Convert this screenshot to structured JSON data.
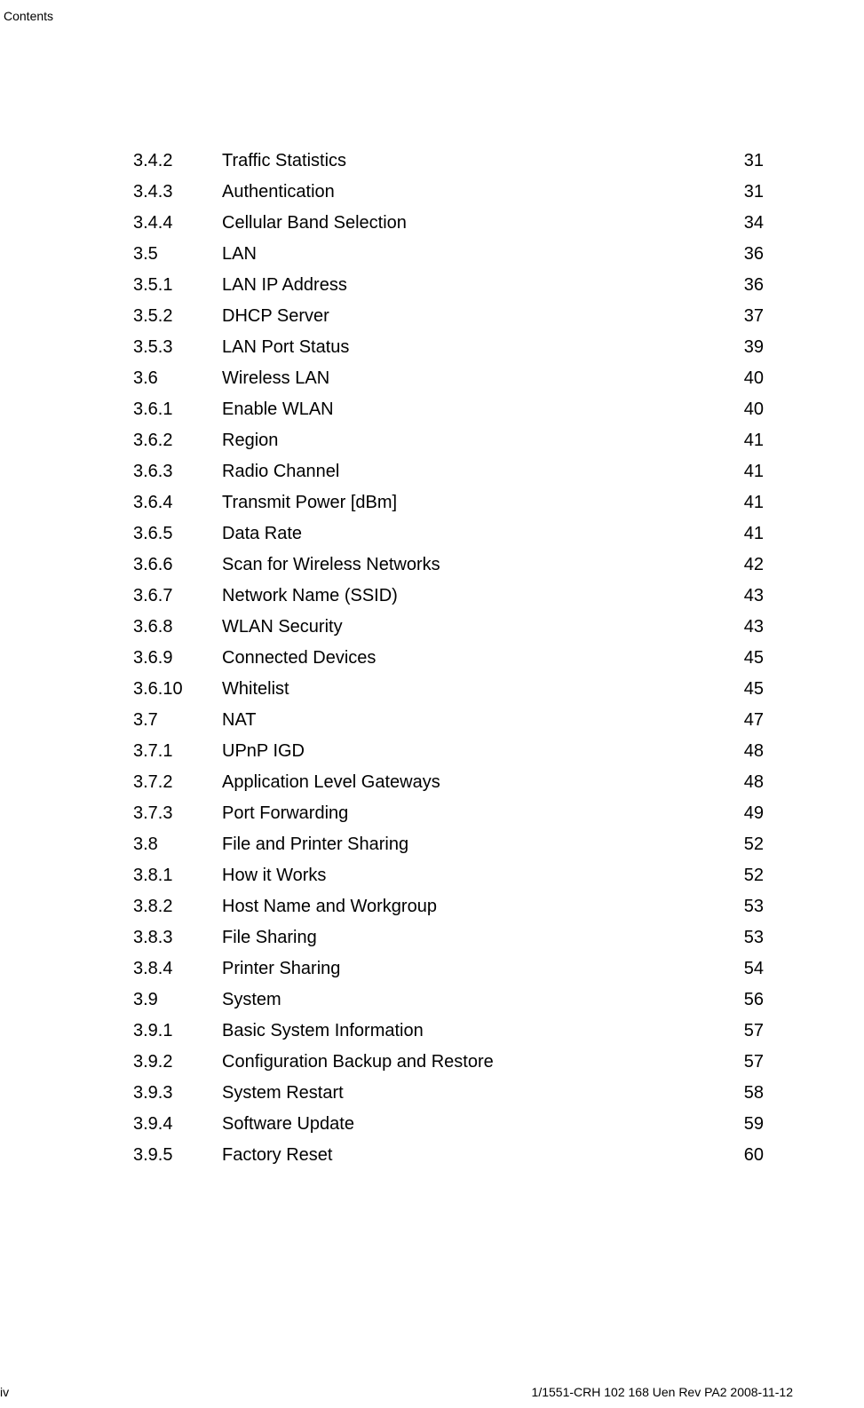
{
  "header": {
    "label": "Contents"
  },
  "toc": {
    "entries": [
      {
        "num": "3.4.2",
        "title": "Traffic Statistics",
        "page": "31"
      },
      {
        "num": "3.4.3",
        "title": "Authentication",
        "page": "31"
      },
      {
        "num": "3.4.4",
        "title": "Cellular Band Selection",
        "page": "34"
      },
      {
        "num": "3.5",
        "title": "LAN",
        "page": "36"
      },
      {
        "num": "3.5.1",
        "title": "LAN IP Address",
        "page": "36"
      },
      {
        "num": "3.5.2",
        "title": "DHCP Server",
        "page": "37"
      },
      {
        "num": "3.5.3",
        "title": "LAN Port Status",
        "page": "39"
      },
      {
        "num": "3.6",
        "title": "Wireless LAN",
        "page": "40"
      },
      {
        "num": "3.6.1",
        "title": "Enable WLAN",
        "page": "40"
      },
      {
        "num": "3.6.2",
        "title": "Region",
        "page": "41"
      },
      {
        "num": "3.6.3",
        "title": "Radio Channel",
        "page": "41"
      },
      {
        "num": "3.6.4",
        "title": "Transmit Power [dBm]",
        "page": "41"
      },
      {
        "num": "3.6.5",
        "title": "Data Rate",
        "page": "41"
      },
      {
        "num": "3.6.6",
        "title": "Scan for Wireless Networks",
        "page": "42"
      },
      {
        "num": "3.6.7",
        "title": "Network Name (SSID)",
        "page": "43"
      },
      {
        "num": "3.6.8",
        "title": "WLAN Security",
        "page": "43"
      },
      {
        "num": "3.6.9",
        "title": "Connected Devices",
        "page": "45"
      },
      {
        "num": "3.6.10",
        "title": "Whitelist",
        "page": "45"
      },
      {
        "num": "3.7",
        "title": "NAT",
        "page": "47"
      },
      {
        "num": "3.7.1",
        "title": "UPnP IGD",
        "page": "48"
      },
      {
        "num": "3.7.2",
        "title": "Application Level Gateways",
        "page": "48"
      },
      {
        "num": "3.7.3",
        "title": "Port Forwarding",
        "page": "49"
      },
      {
        "num": "3.8",
        "title": "File and Printer Sharing",
        "page": "52"
      },
      {
        "num": "3.8.1",
        "title": "How it Works",
        "page": "52"
      },
      {
        "num": "3.8.2",
        "title": "Host Name and Workgroup",
        "page": "53"
      },
      {
        "num": "3.8.3",
        "title": "File Sharing",
        "page": "53"
      },
      {
        "num": "3.8.4",
        "title": "Printer Sharing",
        "page": "54"
      },
      {
        "num": "3.9",
        "title": "System",
        "page": "56"
      },
      {
        "num": "3.9.1",
        "title": "Basic System Information",
        "page": "57"
      },
      {
        "num": "3.9.2",
        "title": "Configuration Backup and Restore",
        "page": "57"
      },
      {
        "num": "3.9.3",
        "title": "System Restart",
        "page": "58"
      },
      {
        "num": "3.9.4",
        "title": "Software Update",
        "page": "59"
      },
      {
        "num": "3.9.5",
        "title": "Factory Reset",
        "page": "60"
      }
    ]
  },
  "footer": {
    "page_num": "iv",
    "doc_id": "1/1551-CRH 102 168 Uen Rev PA2  2008-11-12"
  }
}
